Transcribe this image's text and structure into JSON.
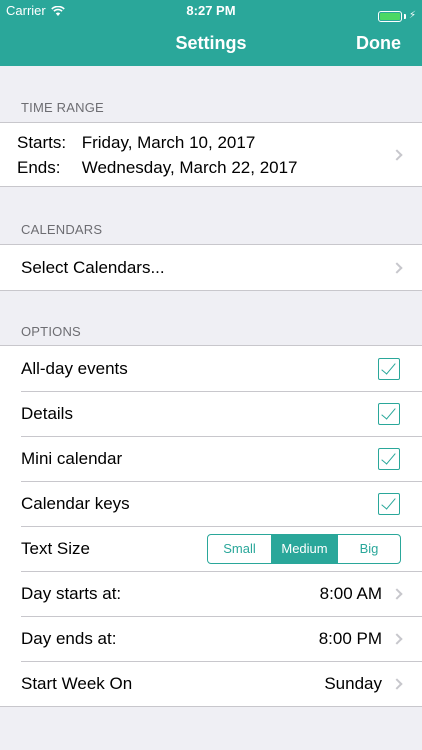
{
  "status_bar": {
    "carrier": "Carrier",
    "time": "8:27 PM"
  },
  "nav": {
    "title": "Settings",
    "done_label": "Done"
  },
  "time_range": {
    "header": "TIME RANGE",
    "starts_label": "Starts:",
    "starts_value": "Friday, March 10, 2017",
    "ends_label": "Ends:",
    "ends_value": "Wednesday, March 22, 2017"
  },
  "calendars": {
    "header": "CALENDARS",
    "select_label": "Select Calendars..."
  },
  "options": {
    "header": "OPTIONS",
    "items": [
      {
        "label": "All-day events",
        "checked": true
      },
      {
        "label": "Details",
        "checked": true
      },
      {
        "label": "Mini calendar",
        "checked": true
      },
      {
        "label": "Calendar keys",
        "checked": true
      }
    ],
    "text_size": {
      "label": "Text Size",
      "options": [
        "Small",
        "Medium",
        "Big"
      ],
      "selected": "Medium"
    },
    "day_starts": {
      "label": "Day starts at:",
      "value": "8:00 AM"
    },
    "day_ends": {
      "label": "Day ends at:",
      "value": "8:00 PM"
    },
    "start_week": {
      "label": "Start Week On",
      "value": "Sunday"
    }
  },
  "colors": {
    "accent": "#2aa79a",
    "background": "#efeff4",
    "separator": "#c8c7cc",
    "battery": "#4cd964"
  }
}
